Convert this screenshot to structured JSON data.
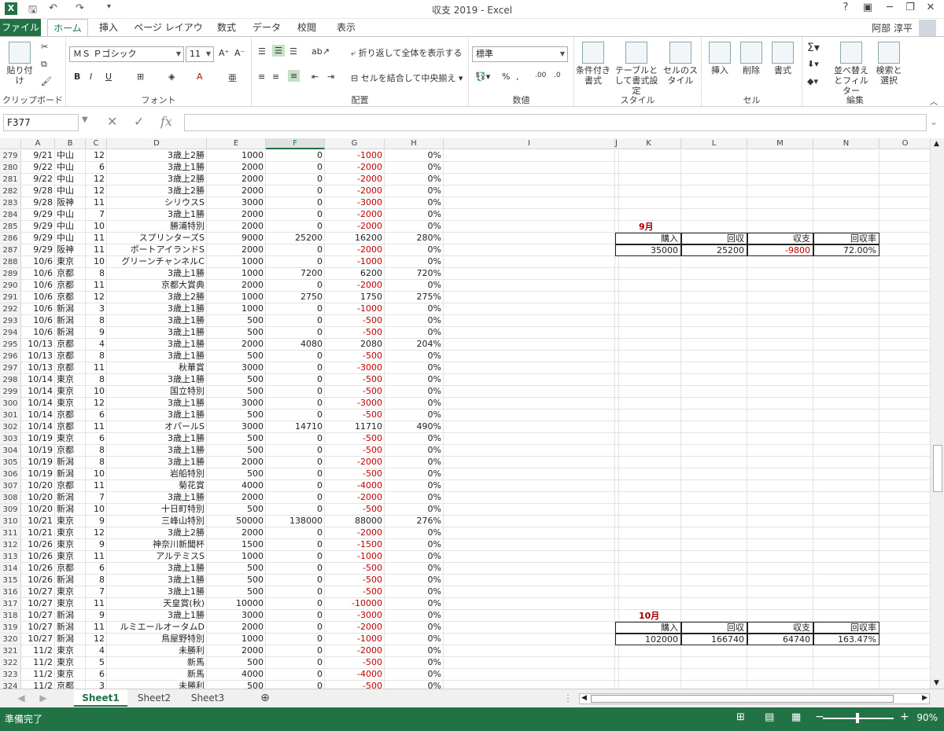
{
  "title": "収支 2019 - Excel",
  "user": "阿部 淳平",
  "tabs": [
    "ファイル",
    "ホーム",
    "挿入",
    "ページ レイアウト",
    "数式",
    "データ",
    "校閲",
    "表示"
  ],
  "ribbon": {
    "paste": "貼り付け",
    "clipboard": "クリップボード",
    "font_name": "ＭＳ Ｐゴシック",
    "font_size": "11",
    "font_label": "フォント",
    "wrap": "折り返して全体を表示する",
    "merge": "セルを結合して中央揃え",
    "align_label": "配置",
    "num_format": "標準",
    "num_label": "数値",
    "cond": "条件付き書式",
    "table": "テーブルとして書式設定",
    "cellstyle": "セルのスタイル",
    "style_label": "スタイル",
    "insert": "挿入",
    "delete": "削除",
    "format": "書式",
    "cell_label": "セル",
    "sort": "並べ替えとフィルター",
    "find": "検索と選択",
    "edit_label": "編集"
  },
  "namebox": "F377",
  "fx": "fx",
  "columns": [
    "A",
    "B",
    "C",
    "D",
    "E",
    "F",
    "G",
    "H",
    "I",
    "J",
    "K",
    "L",
    "M",
    "N",
    "O"
  ],
  "rows": [
    [
      "279",
      "9/21",
      "中山",
      "12",
      "3歳上2勝",
      "1000",
      "0",
      "-1000",
      "0%"
    ],
    [
      "280",
      "9/22",
      "中山",
      "6",
      "3歳上1勝",
      "2000",
      "0",
      "-2000",
      "0%"
    ],
    [
      "281",
      "9/22",
      "中山",
      "12",
      "3歳上2勝",
      "2000",
      "0",
      "-2000",
      "0%"
    ],
    [
      "282",
      "9/28",
      "中山",
      "12",
      "3歳上2勝",
      "2000",
      "0",
      "-2000",
      "0%"
    ],
    [
      "283",
      "9/28",
      "阪神",
      "11",
      "シリウスS",
      "3000",
      "0",
      "-3000",
      "0%"
    ],
    [
      "284",
      "9/29",
      "中山",
      "7",
      "3歳上1勝",
      "2000",
      "0",
      "-2000",
      "0%"
    ],
    [
      "285",
      "9/29",
      "中山",
      "10",
      "勝浦特別",
      "2000",
      "0",
      "-2000",
      "0%"
    ],
    [
      "286",
      "9/29",
      "中山",
      "11",
      "スプリンターズS",
      "9000",
      "25200",
      "16200",
      "280%"
    ],
    [
      "287",
      "9/29",
      "阪神",
      "11",
      "ポートアイランドS",
      "2000",
      "0",
      "-2000",
      "0%"
    ],
    [
      "288",
      "10/6",
      "東京",
      "10",
      "グリーンチャンネルC",
      "1000",
      "0",
      "-1000",
      "0%"
    ],
    [
      "289",
      "10/6",
      "京都",
      "8",
      "3歳上1勝",
      "1000",
      "7200",
      "6200",
      "720%"
    ],
    [
      "290",
      "10/6",
      "京都",
      "11",
      "京都大賞典",
      "2000",
      "0",
      "-2000",
      "0%"
    ],
    [
      "291",
      "10/6",
      "京都",
      "12",
      "3歳上2勝",
      "1000",
      "2750",
      "1750",
      "275%"
    ],
    [
      "292",
      "10/6",
      "新潟",
      "3",
      "3歳上1勝",
      "1000",
      "0",
      "-1000",
      "0%"
    ],
    [
      "293",
      "10/6",
      "新潟",
      "8",
      "3歳上1勝",
      "500",
      "0",
      "-500",
      "0%"
    ],
    [
      "294",
      "10/6",
      "新潟",
      "9",
      "3歳上1勝",
      "500",
      "0",
      "-500",
      "0%"
    ],
    [
      "295",
      "10/13",
      "京都",
      "4",
      "3歳上1勝",
      "2000",
      "4080",
      "2080",
      "204%"
    ],
    [
      "296",
      "10/13",
      "京都",
      "8",
      "3歳上1勝",
      "500",
      "0",
      "-500",
      "0%"
    ],
    [
      "297",
      "10/13",
      "京都",
      "11",
      "秋華賞",
      "3000",
      "0",
      "-3000",
      "0%"
    ],
    [
      "298",
      "10/14",
      "東京",
      "8",
      "3歳上1勝",
      "500",
      "0",
      "-500",
      "0%"
    ],
    [
      "299",
      "10/14",
      "東京",
      "10",
      "国立特別",
      "500",
      "0",
      "-500",
      "0%"
    ],
    [
      "300",
      "10/14",
      "東京",
      "12",
      "3歳上1勝",
      "3000",
      "0",
      "-3000",
      "0%"
    ],
    [
      "301",
      "10/14",
      "京都",
      "6",
      "3歳上1勝",
      "500",
      "0",
      "-500",
      "0%"
    ],
    [
      "302",
      "10/14",
      "京都",
      "11",
      "オパールS",
      "3000",
      "14710",
      "11710",
      "490%"
    ],
    [
      "303",
      "10/19",
      "東京",
      "6",
      "3歳上1勝",
      "500",
      "0",
      "-500",
      "0%"
    ],
    [
      "304",
      "10/19",
      "京都",
      "8",
      "3歳上1勝",
      "500",
      "0",
      "-500",
      "0%"
    ],
    [
      "305",
      "10/19",
      "新潟",
      "8",
      "3歳上1勝",
      "2000",
      "0",
      "-2000",
      "0%"
    ],
    [
      "306",
      "10/19",
      "新潟",
      "10",
      "岩船特別",
      "500",
      "0",
      "-500",
      "0%"
    ],
    [
      "307",
      "10/20",
      "京都",
      "11",
      "菊花賞",
      "4000",
      "0",
      "-4000",
      "0%"
    ],
    [
      "308",
      "10/20",
      "新潟",
      "7",
      "3歳上1勝",
      "2000",
      "0",
      "-2000",
      "0%"
    ],
    [
      "309",
      "10/20",
      "新潟",
      "10",
      "十日町特別",
      "500",
      "0",
      "-500",
      "0%"
    ],
    [
      "310",
      "10/21",
      "東京",
      "9",
      "三峰山特別",
      "50000",
      "138000",
      "88000",
      "276%"
    ],
    [
      "311",
      "10/21",
      "東京",
      "12",
      "3歳上2勝",
      "2000",
      "0",
      "-2000",
      "0%"
    ],
    [
      "312",
      "10/26",
      "東京",
      "9",
      "神奈川新聞杯",
      "1500",
      "0",
      "-1500",
      "0%"
    ],
    [
      "313",
      "10/26",
      "東京",
      "11",
      "アルテミスS",
      "1000",
      "0",
      "-1000",
      "0%"
    ],
    [
      "314",
      "10/26",
      "京都",
      "6",
      "3歳上1勝",
      "500",
      "0",
      "-500",
      "0%"
    ],
    [
      "315",
      "10/26",
      "新潟",
      "8",
      "3歳上1勝",
      "500",
      "0",
      "-500",
      "0%"
    ],
    [
      "316",
      "10/27",
      "東京",
      "7",
      "3歳上1勝",
      "500",
      "0",
      "-500",
      "0%"
    ],
    [
      "317",
      "10/27",
      "東京",
      "11",
      "天皇賞(秋)",
      "10000",
      "0",
      "-10000",
      "0%"
    ],
    [
      "318",
      "10/27",
      "新潟",
      "9",
      "3歳上1勝",
      "3000",
      "0",
      "-3000",
      "0%"
    ],
    [
      "319",
      "10/27",
      "新潟",
      "11",
      "ルミエールオータムD",
      "2000",
      "0",
      "-2000",
      "0%"
    ],
    [
      "320",
      "10/27",
      "新潟",
      "12",
      "鳥屋野特別",
      "1000",
      "0",
      "-1000",
      "0%"
    ],
    [
      "321",
      "11/2",
      "東京",
      "4",
      "未勝利",
      "2000",
      "0",
      "-2000",
      "0%"
    ],
    [
      "322",
      "11/2",
      "東京",
      "5",
      "新馬",
      "500",
      "0",
      "-500",
      "0%"
    ],
    [
      "323",
      "11/2",
      "東京",
      "6",
      "新馬",
      "4000",
      "0",
      "-4000",
      "0%"
    ],
    [
      "324",
      "11/2",
      "京都",
      "3",
      "未勝利",
      "500",
      "0",
      "-500",
      "0%"
    ]
  ],
  "sept": {
    "label": "9月",
    "headers": [
      "購入",
      "回収",
      "収支",
      "回収率"
    ],
    "values": [
      "35000",
      "25200",
      "-9800",
      "72.00%"
    ]
  },
  "oct": {
    "label": "10月",
    "headers": [
      "購入",
      "回収",
      "収支",
      "回収率"
    ],
    "values": [
      "102000",
      "166740",
      "64740",
      "163.47%"
    ]
  },
  "sheets": [
    "Sheet1",
    "Sheet2",
    "Sheet3"
  ],
  "status": "準備完了",
  "zoom": "90%",
  "colors": {
    "accent": "#217346",
    "negative": "#c00000",
    "month": "#a00000"
  }
}
